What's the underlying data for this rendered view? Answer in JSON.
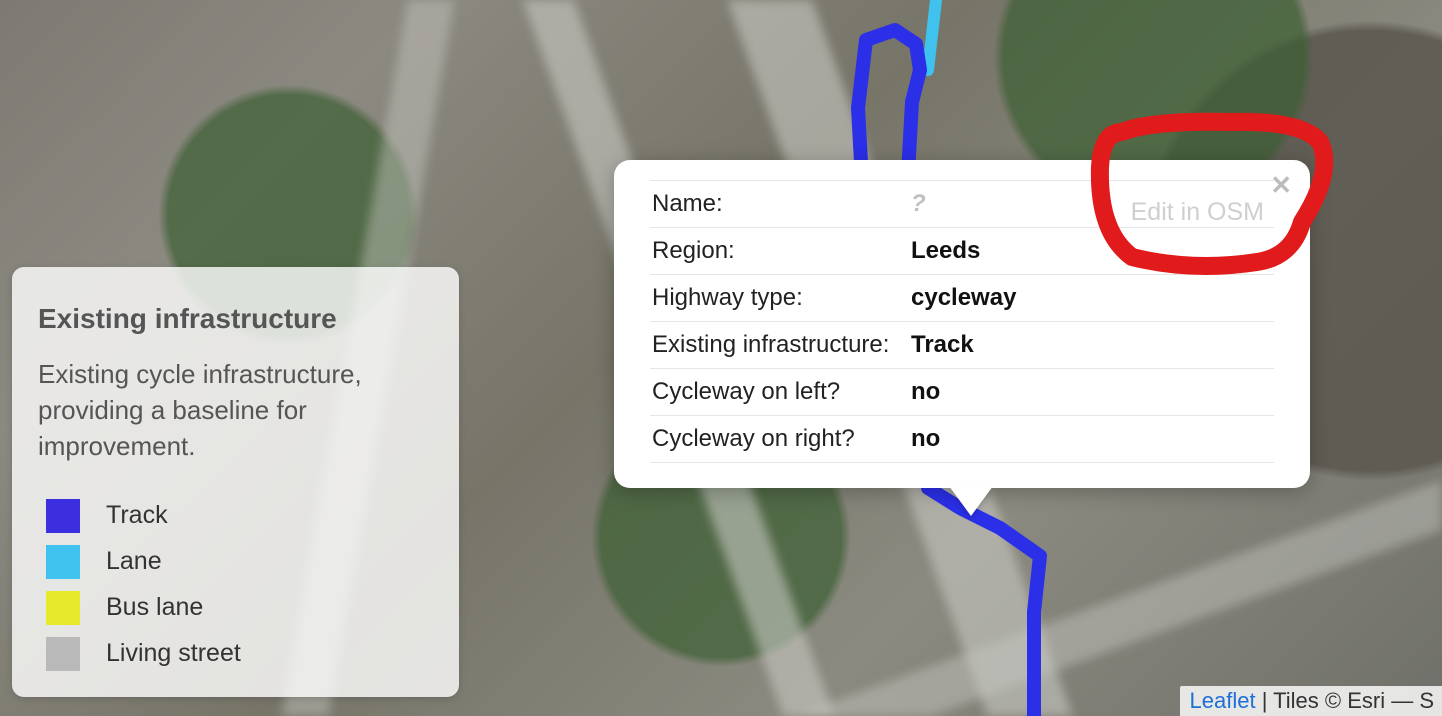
{
  "legend": {
    "title": "Existing infrastructure",
    "description": "Existing cycle infrastructure, providing a baseline for improvement.",
    "items": [
      {
        "label": "Track",
        "color": "#3b2fe0"
      },
      {
        "label": "Lane",
        "color": "#3fc3ee"
      },
      {
        "label": "Bus lane",
        "color": "#e7e92c"
      },
      {
        "label": "Living street",
        "color": "#b9b9b9"
      }
    ]
  },
  "popup": {
    "edit_label": "Edit in OSM",
    "close_glyph": "✕",
    "rows": [
      {
        "label": "Name:",
        "value": "?",
        "unknown": true
      },
      {
        "label": "Region:",
        "value": "Leeds",
        "unknown": false
      },
      {
        "label": "Highway type:",
        "value": "cycleway",
        "unknown": false
      },
      {
        "label": "Existing infrastructure:",
        "value": "Track",
        "unknown": false
      },
      {
        "label": "Cycleway on left?",
        "value": "no",
        "unknown": false
      },
      {
        "label": "Cycleway on right?",
        "value": "no",
        "unknown": false
      }
    ]
  },
  "attribution": {
    "link": "Leaflet",
    "rest": " | Tiles © Esri — S"
  },
  "route_colors": {
    "lane": "#3fc3ee",
    "track": "#2b2fe8",
    "highlight": "#e11b1b"
  }
}
